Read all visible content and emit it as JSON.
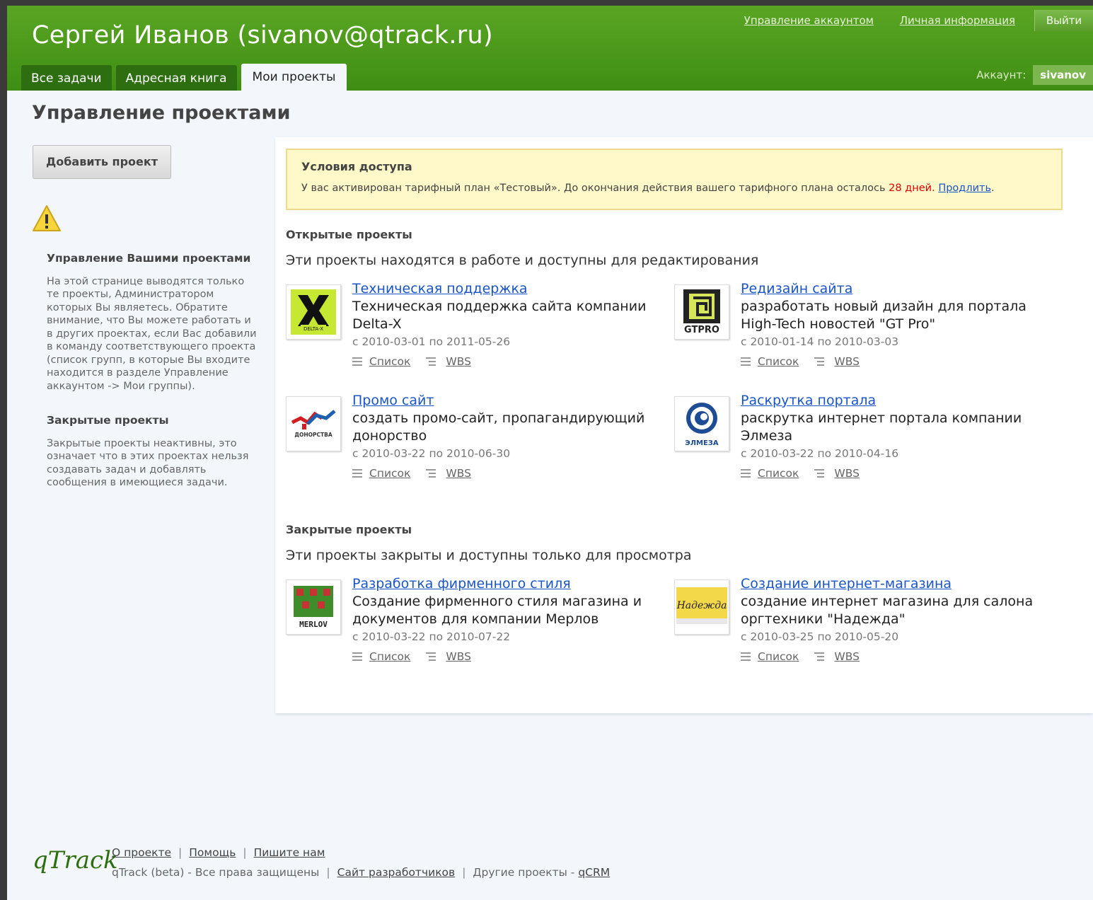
{
  "header": {
    "user_title": "Сергей Иванов (sivanov@qtrack.ru)",
    "links": [
      "Управление аккаунтом",
      "Личная информация"
    ],
    "logout": "Выйти",
    "account_label": "Аккаунт:",
    "account_value": "sivanov"
  },
  "tabs": [
    "Все задачи",
    "Адресная книга",
    "Мои проекты"
  ],
  "active_tab": "Мои проекты",
  "page_title": "Управление проектами",
  "sidebar": {
    "add_button": "Добавить проект",
    "manage_title": "Управление Вашими проектами",
    "manage_text": "На этой странице выводятся только те проекты, Администратором которых Вы являетесь. Обратите внимание, что Вы можете работать и в других проектах, если Вас добавили в команду соответствующего проекта (список групп, в которые Вы входите находится в разделе Управление аккаунтом -> Мои группы).",
    "closed_title": "Закрытые проекты",
    "closed_text": "Закрытые проекты неактивны, это означает что в этих проектах нельзя создавать задач и добавлять сообщения в имеющиеся задачи."
  },
  "notice": {
    "title": "Условия доступа",
    "text_before": "У вас активирован тарифный план «Тестовый». До окончания действия вашего тарифного плана осталось",
    "days": "28 дней.",
    "link": "Продлить",
    "text_after": "."
  },
  "open_section": {
    "title": "Открытые проекты",
    "desc": "Эти проекты находятся в работе и доступны для редактирования",
    "projects": [
      {
        "name": "Техническая поддержка",
        "desc": "Техническая поддержка сайта компании Delta-X",
        "dates": "с 2010-03-01 по 2011-05-26",
        "logo": "DELTA-X"
      },
      {
        "name": "Редизайн сайта",
        "desc": "разработать новый дизайн для портала High-Tech новостей \"GT Pro\"",
        "dates": "с 2010-01-14 по 2010-03-03",
        "logo": "GTPRO"
      },
      {
        "name": "Промо сайт",
        "desc": "создать промо-сайт, пропагандирующий донорство",
        "dates": "с 2010-03-22 по 2010-06-30",
        "logo": "ДОНОРСТВА"
      },
      {
        "name": "Раскрутка портала",
        "desc": "раскрутка интернет портала компании Элмеза",
        "dates": "с 2010-03-22 по 2010-04-16",
        "logo": "ЭЛМЕЗА"
      }
    ]
  },
  "closed_section": {
    "title": "Закрытые проекты",
    "desc": "Эти проекты закрыты и доступны только для просмотра",
    "projects": [
      {
        "name": "Разработка фирменного стиля",
        "desc": "Создание фирменного стиля магазина и документов для компании Мерлов",
        "dates": "с 2010-03-22 по 2010-07-22",
        "logo": "MERLOV"
      },
      {
        "name": "Создание интернет-магазина",
        "desc": "создание интернет магазина для салона оргтехники \"Надежда\"",
        "dates": "с 2010-03-25 по 2010-05-20",
        "logo": "Надежда"
      }
    ]
  },
  "project_links": {
    "list": "Список",
    "wbs": "WBS"
  },
  "footer": {
    "logo": "qTrack",
    "links_row1": [
      "О проекте",
      "Помощь",
      "Пишите нам"
    ],
    "copyright": "qTrack (beta) - Все права защищены",
    "dev_site": "Сайт разработчиков",
    "other_label": "Другие проекты -",
    "other_link": "qCRM"
  },
  "colors": {
    "header_green": "#4c9b1c",
    "link_blue": "#1a55c8",
    "days_red": "#dd0000",
    "notice_bg": "#fff8c8"
  }
}
